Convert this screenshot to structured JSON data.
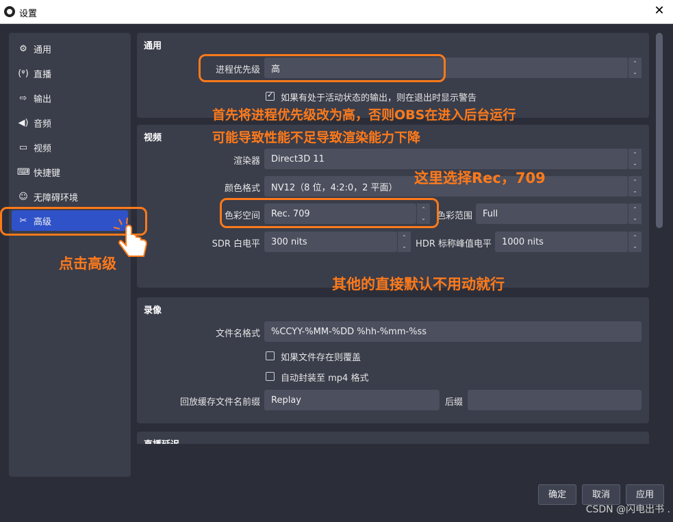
{
  "window": {
    "title": "设置",
    "close_glyph": "✕"
  },
  "sidebar": {
    "items": [
      {
        "label": "通用",
        "icon": "gear-icon",
        "glyph": "⚙"
      },
      {
        "label": "直播",
        "icon": "antenna-icon",
        "glyph": "📡"
      },
      {
        "label": "输出",
        "icon": "output-icon",
        "glyph": "⇨"
      },
      {
        "label": "音频",
        "icon": "speaker-icon",
        "glyph": "🔊"
      },
      {
        "label": "视频",
        "icon": "monitor-icon",
        "glyph": "▭"
      },
      {
        "label": "快捷键",
        "icon": "keyboard-icon",
        "glyph": "⌨"
      },
      {
        "label": "无障碍环境",
        "icon": "accessibility-icon",
        "glyph": "♿"
      },
      {
        "label": "高级",
        "icon": "tools-icon",
        "glyph": "✂"
      }
    ],
    "active_index": 7
  },
  "general": {
    "title": "通用",
    "priority_label": "进程优先级",
    "priority_value": "高",
    "warn_on_exit_label": "如果有处于活动状态的输出，则在退出时显示警告",
    "warn_on_exit_checked": true
  },
  "video": {
    "title": "视频",
    "renderer_label": "渲染器",
    "renderer_value": "Direct3D 11",
    "color_format_label": "颜色格式",
    "color_format_value": "NV12（8 位，4:2:0，2 平面）",
    "color_space_label": "色彩空间",
    "color_space_value": "Rec. 709",
    "color_range_label": "色彩范围",
    "color_range_value": "Full",
    "sdr_white_label": "SDR 白电平",
    "sdr_white_value": "300 nits",
    "hdr_peak_label": "HDR 标称峰值电平",
    "hdr_peak_value": "1000 nits"
  },
  "recording": {
    "title": "录像",
    "filename_format_label": "文件名格式",
    "filename_format_value": "%CCYY-%MM-%DD %hh-%mm-%ss",
    "overwrite_label": "如果文件存在则覆盖",
    "overwrite_checked": false,
    "remux_label": "自动封装至 mp4 格式",
    "remux_checked": false,
    "replay_prefix_label": "回放缓存文件名前缀",
    "replay_prefix_value": "Replay",
    "suffix_label": "后缀",
    "suffix_value": ""
  },
  "stream_delay": {
    "title": "直播延迟"
  },
  "buttons": {
    "ok": "确定",
    "cancel": "取消",
    "apply": "应用"
  },
  "annotations": {
    "line1": "首先将进程优先级改为高，否则OBS在进入后台运行",
    "line2": "可能导致性能不足导致渲染能力下降",
    "rec709": "这里选择Rec，709",
    "click_advanced": "点击高级",
    "defaults": "其他的直接默认不用动就行",
    "color": "#ff7a1a"
  },
  "watermark": "CSDN @闪电出书 ."
}
